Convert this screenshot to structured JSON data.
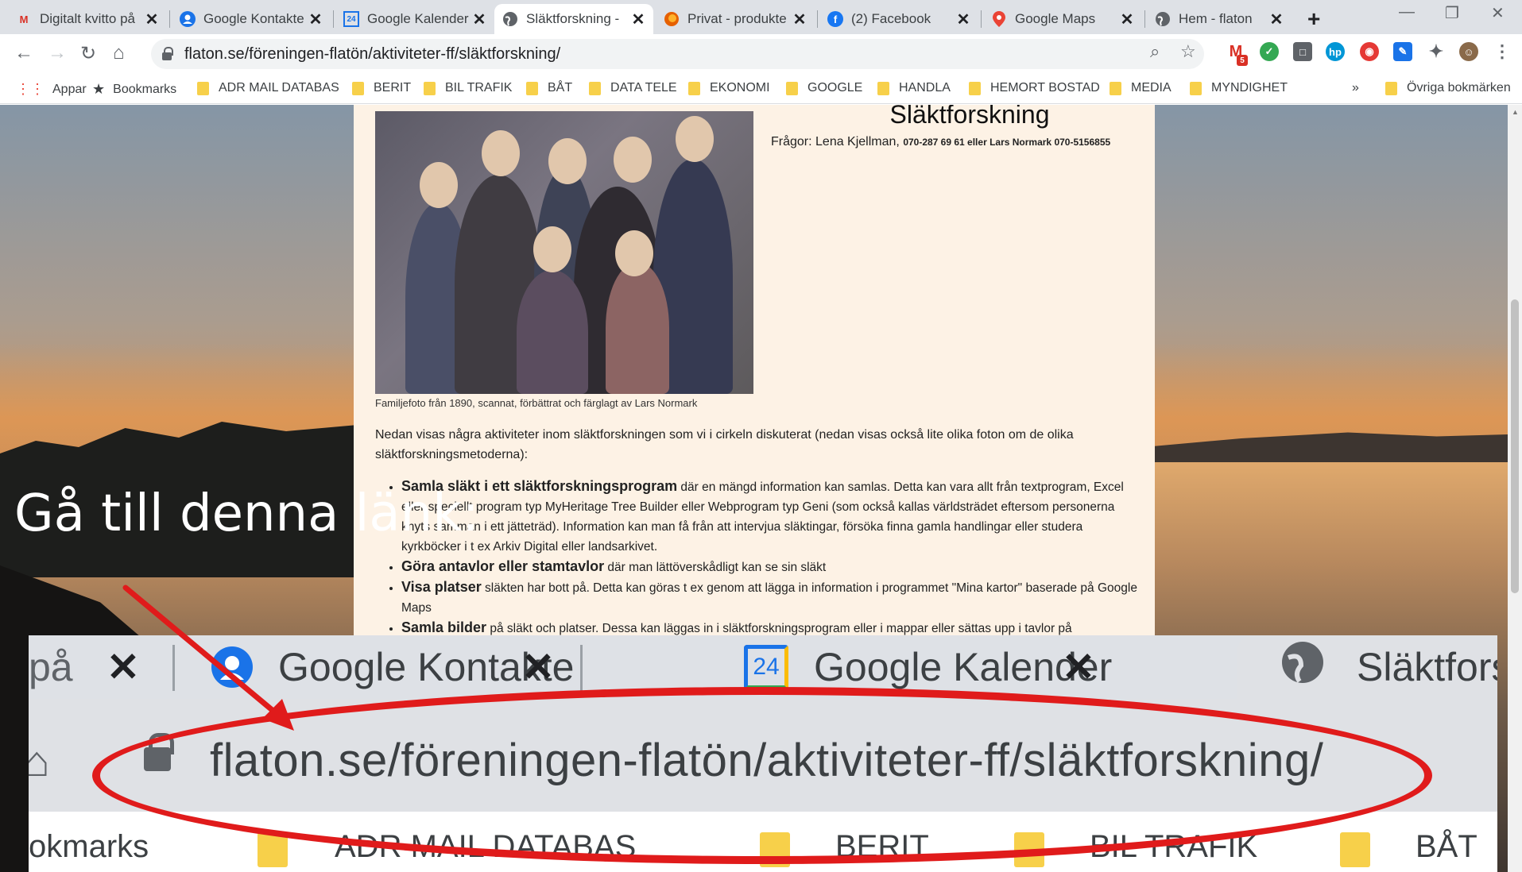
{
  "browser": {
    "tabs": [
      {
        "label": "Digitalt kvitto på",
        "icon": "gmail-icon",
        "active": false
      },
      {
        "label": "Google Kontakte",
        "icon": "contacts-icon",
        "active": false
      },
      {
        "label": "Google Kalender",
        "icon": "calendar-icon",
        "active": false
      },
      {
        "label": "Släktforskning - ",
        "icon": "globe-icon",
        "active": true
      },
      {
        "label": "Privat - produkte",
        "icon": "firefox-icon",
        "active": false
      },
      {
        "label": "(2) Facebook",
        "icon": "facebook-icon",
        "active": false
      },
      {
        "label": "Google Maps",
        "icon": "maps-icon",
        "active": false
      },
      {
        "label": "Hem - flaton",
        "icon": "globe-icon",
        "active": false
      }
    ],
    "url": "flaton.se/föreningen-flatön/aktiviteter-ff/släktforskning/",
    "gmail_badge": "5",
    "calendar_day": "24",
    "bookmarks": {
      "apps": "Appar",
      "bookmarks": "Bookmarks",
      "folders": [
        "ADR MAIL DATABAS",
        "BERIT",
        "BIL TRAFIK",
        "BÅT",
        "DATA TELE",
        "EKONOMI",
        "GOOGLE",
        "HANDLA",
        "HEMORT BOSTAD",
        "MEDIA",
        "MYNDIGHET"
      ],
      "more": "»",
      "other": "Övriga bokmärken"
    }
  },
  "page": {
    "title": "Släktforskning",
    "contact_prefix": "Frågor: Lena Kjellman, ",
    "contact_bold": "070-287 69 61 eller Lars Normark 070-5156855",
    "photo_caption": "Familjefoto från 1890, scannat, förbättrat och färglagt av Lars Normark",
    "intro": "Nedan visas några aktiviteter inom släktforskningen som vi i cirkeln diskuterat (nedan visas också lite olika foton om de olika släktforskningsmetoderna):",
    "bullets": [
      {
        "bold": "Samla släkt i ett släktforskningsprogram",
        "text": " där en mängd information kan samlas. Detta kan vara allt från textprogram, Excel eller speciellt program typ MyHeritage Tree Builder eller Webprogram typ Geni (som också kallas världsträdet eftersom personerna knyts samman i ett jätteträd). Information kan man få från att intervjua släktingar, försöka finna gamla handlingar eller studera kyrkböcker i t ex Arkiv Digital eller landsarkivet."
      },
      {
        "bold": "Göra antavlor eller stamtavlor",
        "text": " där man lättöverskådligt kan se sin släkt"
      },
      {
        "bold": "Visa platser",
        "text": " släkten har bott på. Detta kan göras t ex genom att lägga in information i programmet \"Mina kartor\" baserade på Google Maps"
      },
      {
        "bold": "Samla bilder",
        "text": " på släkt och platser. Dessa kan läggas in i släktforskningsprogram eller i mappar eller sättas upp i tavlor på"
      }
    ]
  },
  "annotation": {
    "text": "Gå till denna länk:",
    "arrow_color": "#e01b1b",
    "zoom_tabs": [
      "på",
      "Google Kontakte",
      "Google Kalender",
      "Släktfors"
    ],
    "zoom_url": "flaton.se/föreningen-flatön/aktiviteter-ff/släktforskning/",
    "zoom_bookmarks": [
      "okmarks",
      "ADR MAIL DATABAS",
      "BERIT",
      "BIL TRAFIK",
      "BÅT"
    ]
  }
}
